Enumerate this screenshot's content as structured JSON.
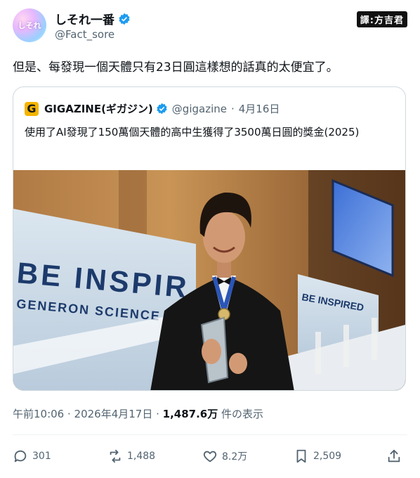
{
  "author": {
    "display_name": "しそれ一番",
    "handle": "@Fact_sore",
    "avatar_text": "しそれ"
  },
  "translator_badge": "譯:方吉君",
  "tweet": {
    "text": "但是、每發現一個天體只有23日圓這樣想的話真的太便宜了。"
  },
  "quote": {
    "logo_letter": "G",
    "name": "GIGAZINE(ギガジン)",
    "handle": "@gigazine",
    "separator": "·",
    "date": "4月16日",
    "text": "使用了AI發現了150萬個天體的高中生獲得了3500萬日圓的獎金(2025)",
    "image_text": {
      "banner_left_1": "BE INSPIR",
      "banner_left_2": "GENERON SCIENCE TA",
      "banner_right": "BE INSPIRED"
    }
  },
  "meta": {
    "time": "午前10:06 · 2026年4月17日 · ",
    "views": "1,487.6万",
    "views_suffix": " 件の表示"
  },
  "actions": {
    "replies": "301",
    "retweets": "1,488",
    "likes": "8.2万",
    "bookmarks": "2,509"
  },
  "colors": {
    "verified": "#1d9bf0",
    "muted": "#536471",
    "text": "#0f1419",
    "border": "#cfd9de"
  }
}
